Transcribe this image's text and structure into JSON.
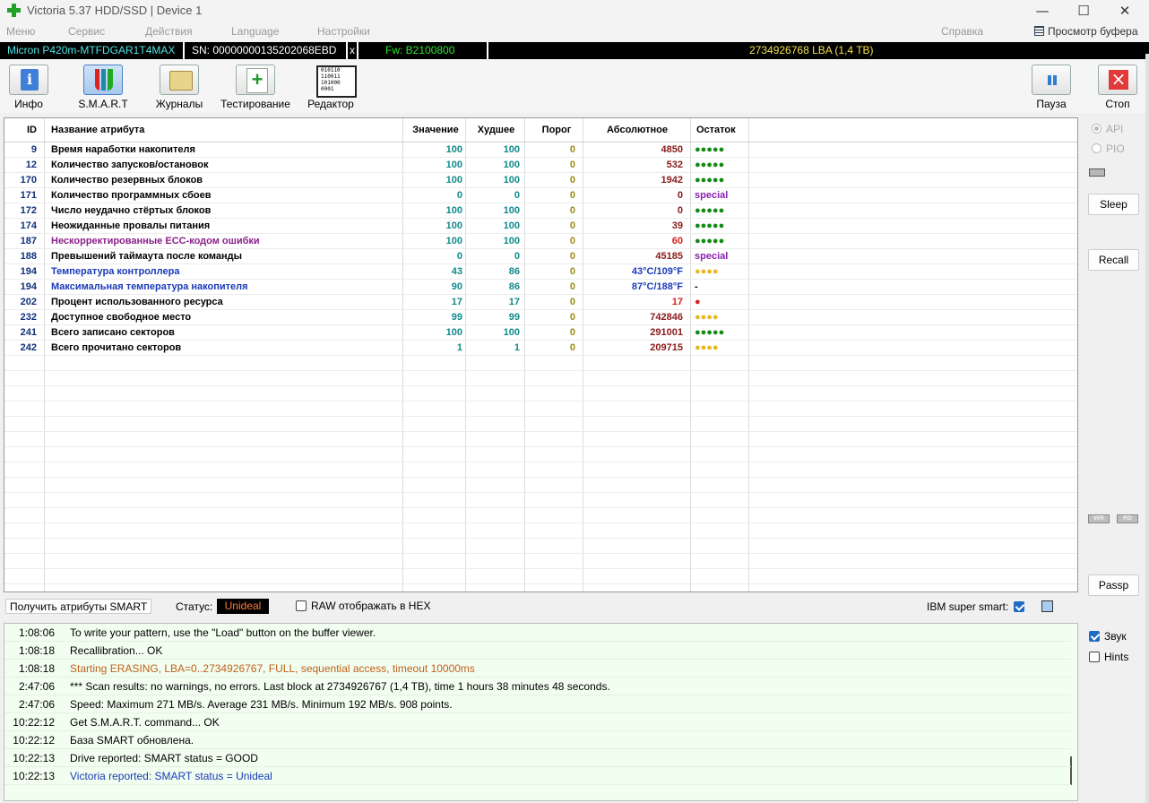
{
  "window": {
    "title": "Victoria 5.37 HDD/SSD | Device 1",
    "controls": [
      "—",
      "☐",
      "✕"
    ]
  },
  "menu": {
    "items": [
      "Меню",
      "Сервис",
      "Действия",
      "Language",
      "Настройки"
    ],
    "help": "Справка",
    "buffer_viewer": "Просмотр буфера"
  },
  "device": {
    "model": "Micron P420m-MTFDGAR1T4MAX",
    "serial": "SN: 00000000135202068EBD",
    "close": "x",
    "firmware": "Fw: B2100800",
    "lba": "2734926768 LBA (1,4 TB)"
  },
  "toolbar": {
    "buttons": [
      {
        "label": "Инфо",
        "icon": "info-icon"
      },
      {
        "label": "S.M.A.R.T",
        "icon": "smart-icon",
        "active": true
      },
      {
        "label": "Журналы",
        "icon": "logs-icon"
      },
      {
        "label": "Тестирование",
        "icon": "test-icon"
      },
      {
        "label": "Редактор",
        "icon": "editor-icon"
      }
    ],
    "pause": "Пауза",
    "stop": "Стоп"
  },
  "smart": {
    "headers": {
      "id": "ID",
      "name": "Название атрибута",
      "value": "Значение",
      "worst": "Худшее",
      "threshold": "Порог",
      "absolute": "Абсолютное",
      "remaining": "Остаток"
    },
    "rows": [
      {
        "id": "9",
        "name": "Время наработки накопителя",
        "value": "100",
        "worst": "100",
        "threshold": "0",
        "absolute": "4850",
        "remaining": "●●●●●",
        "name_color": "#000000",
        "abs_color": "#8a1a1a",
        "rem_color": "#138a13"
      },
      {
        "id": "12",
        "name": "Количество запусков/остановок",
        "value": "100",
        "worst": "100",
        "threshold": "0",
        "absolute": "532",
        "remaining": "●●●●●",
        "name_color": "#000000",
        "abs_color": "#8a1a1a",
        "rem_color": "#138a13"
      },
      {
        "id": "170",
        "name": "Количество резервных блоков",
        "value": "100",
        "worst": "100",
        "threshold": "0",
        "absolute": "1942",
        "remaining": "●●●●●",
        "name_color": "#000000",
        "abs_color": "#8a1a1a",
        "rem_color": "#138a13"
      },
      {
        "id": "171",
        "name": "Количество программных сбоев",
        "value": "0",
        "worst": "0",
        "threshold": "0",
        "absolute": "0",
        "remaining": "special",
        "name_color": "#000000",
        "abs_color": "#8a1a1a",
        "rem_color": "#8a1fb0"
      },
      {
        "id": "172",
        "name": "Число неудачно стёртых блоков",
        "value": "100",
        "worst": "100",
        "threshold": "0",
        "absolute": "0",
        "remaining": "●●●●●",
        "name_color": "#000000",
        "abs_color": "#8a1a1a",
        "rem_color": "#138a13"
      },
      {
        "id": "174",
        "name": "Неожиданные провалы питания",
        "value": "100",
        "worst": "100",
        "threshold": "0",
        "absolute": "39",
        "remaining": "●●●●●",
        "name_color": "#000000",
        "abs_color": "#8a1a1a",
        "rem_color": "#138a13"
      },
      {
        "id": "187",
        "name": "Нескорректированные ECC-кодом ошибки",
        "value": "100",
        "worst": "100",
        "threshold": "0",
        "absolute": "60",
        "remaining": "●●●●●",
        "name_color": "#8a1f8a",
        "abs_color": "#d42020",
        "rem_color": "#138a13"
      },
      {
        "id": "188",
        "name": "Превышений таймаута после команды",
        "value": "0",
        "worst": "0",
        "threshold": "0",
        "absolute": "45185",
        "remaining": "special",
        "name_color": "#000000",
        "abs_color": "#8a1a1a",
        "rem_color": "#8a1fb0"
      },
      {
        "id": "194",
        "name": "Температура контроллера",
        "value": "43",
        "worst": "86",
        "threshold": "0",
        "absolute": "43°C/109°F",
        "remaining": "●●●●",
        "name_color": "#1a3ab8",
        "abs_color": "#1a3ab8",
        "rem_color": "#e8b820"
      },
      {
        "id": "194",
        "name": "Максимальная температура накопителя",
        "value": "90",
        "worst": "86",
        "threshold": "0",
        "absolute": "87°C/188°F",
        "remaining": "-",
        "name_color": "#1a3ab8",
        "abs_color": "#1a3ab8",
        "rem_color": "#000000"
      },
      {
        "id": "202",
        "name": "Процент использованного ресурса",
        "value": "17",
        "worst": "17",
        "threshold": "0",
        "absolute": "17",
        "remaining": "●",
        "name_color": "#000000",
        "abs_color": "#d42020",
        "rem_color": "#d42020"
      },
      {
        "id": "232",
        "name": "Доступное свободное место",
        "value": "99",
        "worst": "99",
        "threshold": "0",
        "absolute": "742846",
        "remaining": "●●●●",
        "name_color": "#000000",
        "abs_color": "#8a1a1a",
        "rem_color": "#e8b820"
      },
      {
        "id": "241",
        "name": "Всего записано секторов",
        "value": "100",
        "worst": "100",
        "threshold": "0",
        "absolute": "291001",
        "remaining": "●●●●●",
        "name_color": "#000000",
        "abs_color": "#8a1a1a",
        "rem_color": "#138a13"
      },
      {
        "id": "242",
        "name": "Всего прочитано секторов",
        "value": "1",
        "worst": "1",
        "threshold": "0",
        "absolute": "209715",
        "remaining": "●●●●",
        "name_color": "#000000",
        "abs_color": "#8a1a1a",
        "rem_color": "#e8b820"
      }
    ]
  },
  "statusbar": {
    "get_smart": "Получить атрибуты SMART",
    "status_label": "Статус:",
    "status_value": "Unideal",
    "raw_hex": "RAW отображать в HEX",
    "ibm_label": "IBM super smart:"
  },
  "side": {
    "api": "API",
    "pio": "PIO",
    "sleep": "Sleep",
    "recall": "Recall",
    "wr": "WR",
    "rd": "RD",
    "passp": "Passp",
    "sound": "Звук",
    "hints": "Hints"
  },
  "log": [
    {
      "time": "1:08:06",
      "msg": "To write your pattern, use the \"Load\" button on the buffer viewer.",
      "color": "#000000"
    },
    {
      "time": "1:08:18",
      "msg": "Recallibration... OK",
      "color": "#000000"
    },
    {
      "time": "1:08:18",
      "msg": "Starting ERASING, LBA=0..2734926767, FULL, sequential access, timeout 10000ms",
      "color": "#c0601a"
    },
    {
      "time": "2:47:06",
      "msg": "*** Scan results: no warnings, no errors. Last block at 2734926767 (1,4 TB), time 1 hours 38 minutes 48 seconds.",
      "color": "#000000"
    },
    {
      "time": "2:47:06",
      "msg": "Speed: Maximum 271 MB/s. Average 231 MB/s. Minimum 192 MB/s. 908 points.",
      "color": "#000000"
    },
    {
      "time": "10:22:12",
      "msg": "Get S.M.A.R.T. command... OK",
      "color": "#000000"
    },
    {
      "time": "10:22:12",
      "msg": "База SMART обновлена.",
      "color": "#000000"
    },
    {
      "time": "10:22:13",
      "msg": "Drive reported: SMART status = GOOD",
      "color": "#000000"
    },
    {
      "time": "10:22:13",
      "msg": "Victoria reported: SMART status = Unideal",
      "color": "#1a3ab8"
    }
  ]
}
